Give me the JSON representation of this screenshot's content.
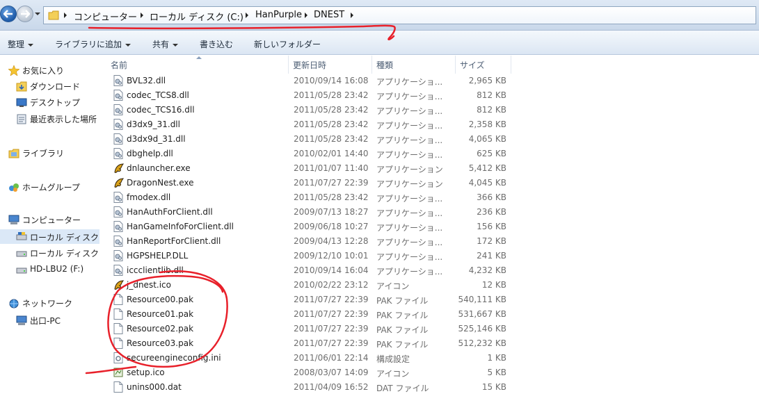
{
  "address": {
    "crumbs": [
      "コンピューター",
      "ローカル ディスク (C:)",
      "HanPurple",
      "DNEST"
    ]
  },
  "toolbar": {
    "organize": "整理",
    "add_to_library": "ライブラリに追加",
    "share": "共有",
    "burn": "書き込む",
    "new_folder": "新しいフォルダー"
  },
  "sidebar": {
    "favorites": "お気に入り",
    "downloads": "ダウンロード",
    "desktop": "デスクトップ",
    "recent": "最近表示した場所",
    "libraries": "ライブラリ",
    "homegroup": "ホームグループ",
    "computer": "コンピューター",
    "local_disk_1": "ローカル ディスク",
    "local_disk_2": "ローカル ディスク",
    "hd": "HD-LBU2 (F:)",
    "network": "ネットワーク",
    "pc": "出口-PC"
  },
  "columns": {
    "name": "名前",
    "date": "更新日時",
    "type": "種類",
    "size": "サイズ"
  },
  "files": [
    {
      "name": "BVL32.dll",
      "date": "2010/09/14 16:08",
      "type": "アプリケーショ...",
      "size": "2,965 KB",
      "icon": "dll-icon"
    },
    {
      "name": "codec_TCS8.dll",
      "date": "2011/05/28 23:42",
      "type": "アプリケーショ...",
      "size": "812 KB",
      "icon": "dll-icon"
    },
    {
      "name": "codec_TCS16.dll",
      "date": "2011/05/28 23:42",
      "type": "アプリケーショ...",
      "size": "812 KB",
      "icon": "dll-icon"
    },
    {
      "name": "d3dx9_31.dll",
      "date": "2011/05/28 23:42",
      "type": "アプリケーショ...",
      "size": "2,358 KB",
      "icon": "dll-icon"
    },
    {
      "name": "d3dx9d_31.dll",
      "date": "2011/05/28 23:42",
      "type": "アプリケーショ...",
      "size": "4,065 KB",
      "icon": "dll-icon"
    },
    {
      "name": "dbghelp.dll",
      "date": "2010/02/01 14:40",
      "type": "アプリケーショ...",
      "size": "625 KB",
      "icon": "dll-icon"
    },
    {
      "name": "dnlauncher.exe",
      "date": "2011/01/07 11:40",
      "type": "アプリケーション",
      "size": "5,412 KB",
      "icon": "dragon-icon"
    },
    {
      "name": "DragonNest.exe",
      "date": "2011/07/27 22:39",
      "type": "アプリケーション",
      "size": "4,045 KB",
      "icon": "dragon-icon"
    },
    {
      "name": "fmodex.dll",
      "date": "2011/05/28 23:42",
      "type": "アプリケーショ...",
      "size": "366 KB",
      "icon": "dll-icon"
    },
    {
      "name": "HanAuthForClient.dll",
      "date": "2009/07/13 18:27",
      "type": "アプリケーショ...",
      "size": "236 KB",
      "icon": "dll-icon"
    },
    {
      "name": "HanGameInfoForClient.dll",
      "date": "2009/06/18 10:27",
      "type": "アプリケーショ...",
      "size": "156 KB",
      "icon": "dll-icon"
    },
    {
      "name": "HanReportForClient.dll",
      "date": "2009/04/13 12:28",
      "type": "アプリケーショ...",
      "size": "172 KB",
      "icon": "dll-icon"
    },
    {
      "name": "HGPSHELP.DLL",
      "date": "2009/12/10 10:01",
      "type": "アプリケーショ...",
      "size": "241 KB",
      "icon": "dll-icon"
    },
    {
      "name": "iccclientlib.dll",
      "date": "2010/09/14 16:04",
      "type": "アプリケーショ...",
      "size": "4,232 KB",
      "icon": "dll-icon"
    },
    {
      "name": "j_dnest.ico",
      "date": "2010/02/22 23:12",
      "type": "アイコン",
      "size": "12 KB",
      "icon": "dragon-icon"
    },
    {
      "name": "Resource00.pak",
      "date": "2011/07/27 22:39",
      "type": "PAK ファイル",
      "size": "540,111 KB",
      "icon": "file-icon"
    },
    {
      "name": "Resource01.pak",
      "date": "2011/07/27 22:39",
      "type": "PAK ファイル",
      "size": "531,667 KB",
      "icon": "file-icon"
    },
    {
      "name": "Resource02.pak",
      "date": "2011/07/27 22:39",
      "type": "PAK ファイル",
      "size": "525,146 KB",
      "icon": "file-icon"
    },
    {
      "name": "Resource03.pak",
      "date": "2011/07/27 22:39",
      "type": "PAK ファイル",
      "size": "512,232 KB",
      "icon": "file-icon"
    },
    {
      "name": "secureengineconfig.ini",
      "date": "2011/06/01 22:14",
      "type": "構成設定",
      "size": "1 KB",
      "icon": "ini-icon"
    },
    {
      "name": "setup.ico",
      "date": "2008/03/07 14:09",
      "type": "アイコン",
      "size": "5 KB",
      "icon": "ico-icon"
    },
    {
      "name": "unins000.dat",
      "date": "2011/04/09 16:52",
      "type": "DAT ファイル",
      "size": "15 KB",
      "icon": "file-icon"
    }
  ],
  "colors": {
    "annotation": "#e8202a",
    "selection": "#dbe8f7"
  }
}
